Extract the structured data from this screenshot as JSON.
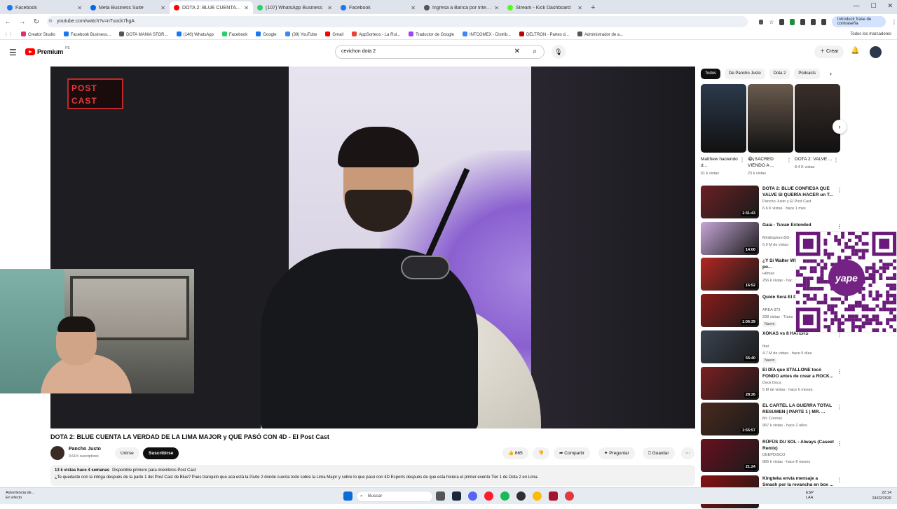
{
  "browser": {
    "tabs": [
      {
        "label": "Facebook",
        "color": "#1877f2",
        "active": false
      },
      {
        "label": "Meta Business Suite",
        "color": "#0668e1",
        "active": false
      },
      {
        "label": "DOTA 2: BLUE CUENTA LA V",
        "color": "#ff0000",
        "active": true
      },
      {
        "label": "(107) WhatsApp Business",
        "color": "#25d366",
        "active": false
      },
      {
        "label": "Facebook",
        "color": "#1877f2",
        "active": false
      },
      {
        "label": "Ingresa a Banca por Internet BC",
        "color": "#555555",
        "active": false
      },
      {
        "label": "Stream - Kick Dashboard",
        "color": "#53fc18",
        "active": false
      }
    ],
    "url": "youtube.com/watch?v=nTuock7hgA",
    "password_prompt": "Introducir frase de contraseña",
    "bookmarks": [
      "Creator Studio",
      "Facebook Business...",
      "DOTA MANIA STOR...",
      "(140) WhatsApp",
      "Facebook",
      "Google",
      "(39) YouTube",
      "Gmail",
      "AppSorteos - La Rul...",
      "Traductor de Google",
      "INTCOMEX - Distrib...",
      "DELTRON - Partes d...",
      "Administrador de a..."
    ],
    "bookmarks_all": "Todos los marcadores"
  },
  "youtube": {
    "logo_text": "Premium",
    "logo_sup": "PE",
    "search_value": "cevichon dota 2",
    "create_label": "Crear",
    "video": {
      "overlay_logo_line1": "POST",
      "overlay_logo_line2": "CAST",
      "title": "DOTA 2: BLUE CUENTA LA VERDAD DE LA LIMA MAJOR y QUE PASÓ CON 4D - El Post Cast",
      "channel": "Pancho Justo",
      "subscribers": "9.64 K suscriptores",
      "join": "Unirse",
      "subscribe": "Suscribirse",
      "likes": "665",
      "share": "Compartir",
      "ask": "Preguntar",
      "save": "Guardar",
      "views": "13 k vistas  hace 4 semanas",
      "members": "Disponible primero para miembros  Post Cast",
      "description": "¿Te quedaste con la intriga después de la parte 1 del Post Cast de Blue? Pues tranquilo que acá está la Parte 2 donde cuenta todo sobre la Lima Major y sobre lo que pasó con 4D Esports después de que esta hiciera el primer evento Tier 1 de Dota 2 en Lima."
    },
    "chips": [
      "Todos",
      "De Pancho Justo",
      "Dota 2",
      "Pódcasts"
    ],
    "shorts": [
      {
        "title": "Matthew haciendo d...",
        "views": "61 k vistas",
        "color": "#2b3a4c"
      },
      {
        "title": "😂¡SACRED VIENDO A ...",
        "views": "23 k vistas",
        "color": "#6b5b4e"
      },
      {
        "title": "DOTA 2: VALVE ...",
        "views": "8.4 K vistas",
        "color": "#3a2f2a"
      }
    ],
    "recommended": [
      {
        "title": "DOTA 2: BLUE CONFIESA QUE VALVE SI QUERÍA HACER un T...",
        "channel": "Pancho Justo y El Post Cast",
        "meta": "6.6 K vistas · hace 1 mes",
        "duration": "1:31:43",
        "color": "#6a2024",
        "new": ""
      },
      {
        "title": "Gaia - Tuvan Extended",
        "channel": "MiniExplorerSG",
        "meta": "5.9 M de vistas ·",
        "duration": "14:00",
        "color": "#c7a6d8",
        "new": ""
      },
      {
        "title": "¿Y Si Walter White Sentenciado po...",
        "channel": "Hitman",
        "meta": "256 k vistas · hac",
        "duration": "16:52",
        "color": "#b32722",
        "new": ""
      },
      {
        "title": "Quién Será El P Presidente Del",
        "channel": "AREA 973",
        "meta": "298 vistas · Trans",
        "duration": "1:06:39",
        "color": "#8a1c1a",
        "new": "Nuevo"
      },
      {
        "title": "XOKAS vs 8 HATERS",
        "channel": "Ibai",
        "meta": "4.7 M de vistas · hace 5 días",
        "duration": "55:40",
        "color": "#3b4451",
        "new": "Nuevo"
      },
      {
        "title": "El DÍA que STALLONE tocó FONDO antes de crear a ROCK...",
        "channel": "Deck Docs",
        "meta": "5 M de vistas · hace 6 meses",
        "duration": "28:26",
        "color": "#7b1f22",
        "new": ""
      },
      {
        "title": "EL CARTEL LA GUERRA TOTAL RESUMEN | PARTE 1 | MR. ...",
        "channel": "Mr. Cormac",
        "meta": "967 k vistas · hace 2 años",
        "duration": "1:55:57",
        "color": "#4a2a1e",
        "new": ""
      },
      {
        "title": "RÜFÜS DU SOL - Always (Caseet Remix)",
        "channel": "DEEPDISCO",
        "meta": "886 k vistas · hace 8 meses",
        "duration": "21:24",
        "color": "#6a1020",
        "new": ""
      },
      {
        "title": "Kingteka envía mensaje a Smash por la revancha en box ...",
        "channel": "",
        "meta": "",
        "duration": "",
        "color": "#8a1010",
        "new": ""
      }
    ]
  },
  "overlay": {
    "qr_text": "yape"
  },
  "taskbar": {
    "left_line1": "Advertencia de...",
    "left_line2": "En efecto",
    "search": "Buscar",
    "lang1": "ESP",
    "lang2": "LAA",
    "time": "22:14",
    "date": "24/02/2026"
  }
}
